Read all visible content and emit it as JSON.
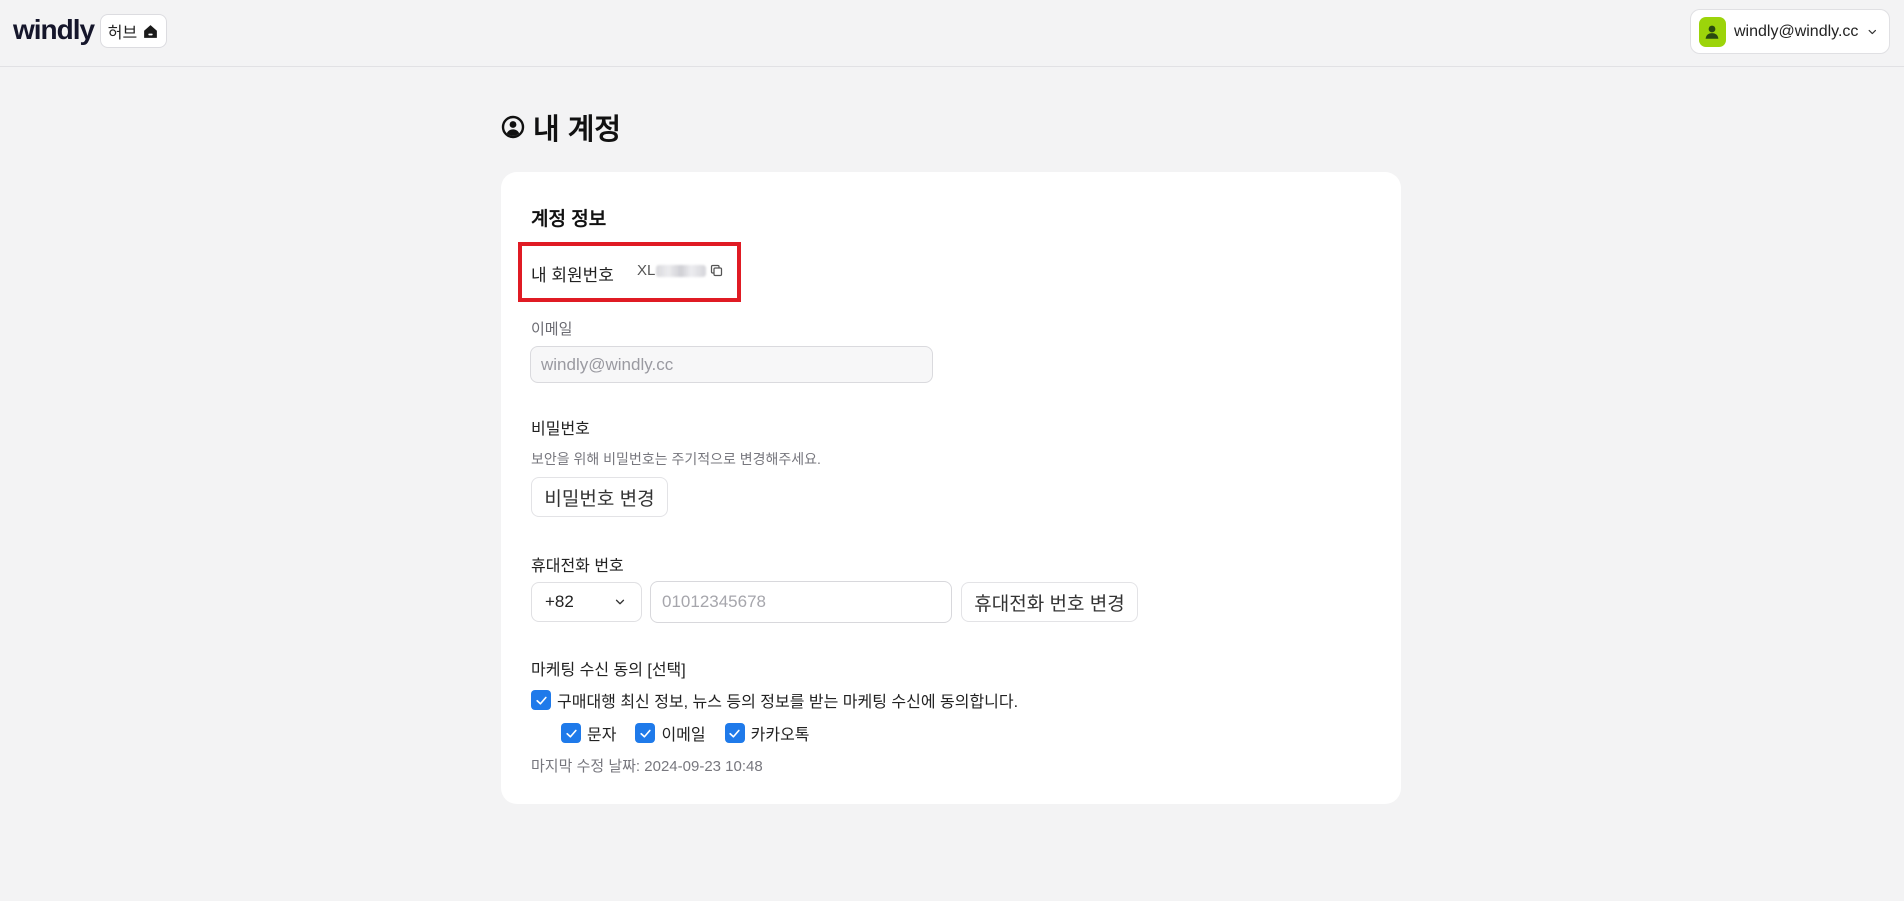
{
  "header": {
    "logo": "windly",
    "hub_label": "허브",
    "user_email": "windly@windly.cc"
  },
  "page": {
    "title": "내 계정"
  },
  "account": {
    "section_title": "계정 정보",
    "member_no_label": "내 회원번호",
    "member_no_prefix": "XL",
    "email_label": "이메일",
    "email_value": "windly@windly.cc",
    "password_label": "비밀번호",
    "password_hint": "보안을 위해 비밀번호는 주기적으로 변경해주세요.",
    "password_button": "비밀번호 변경",
    "phone_label": "휴대전화 번호",
    "country_code": "+82",
    "phone_placeholder": "01012345678",
    "phone_button": "휴대전화 번호 변경",
    "marketing_label": "마케팅 수신 동의 [선택]",
    "marketing_consent": "구매대행 최신 정보, 뉴스 등의 정보를 받는 마케팅 수신에 동의합니다.",
    "channels": {
      "sms": "문자",
      "email": "이메일",
      "kakao": "카카오톡"
    },
    "last_modified": "마지막 수정 날짜: 2024-09-23 10:48"
  },
  "colors": {
    "accent": "#1f7aea",
    "highlight": "#e01b24",
    "avatar": "#9cd40a"
  }
}
